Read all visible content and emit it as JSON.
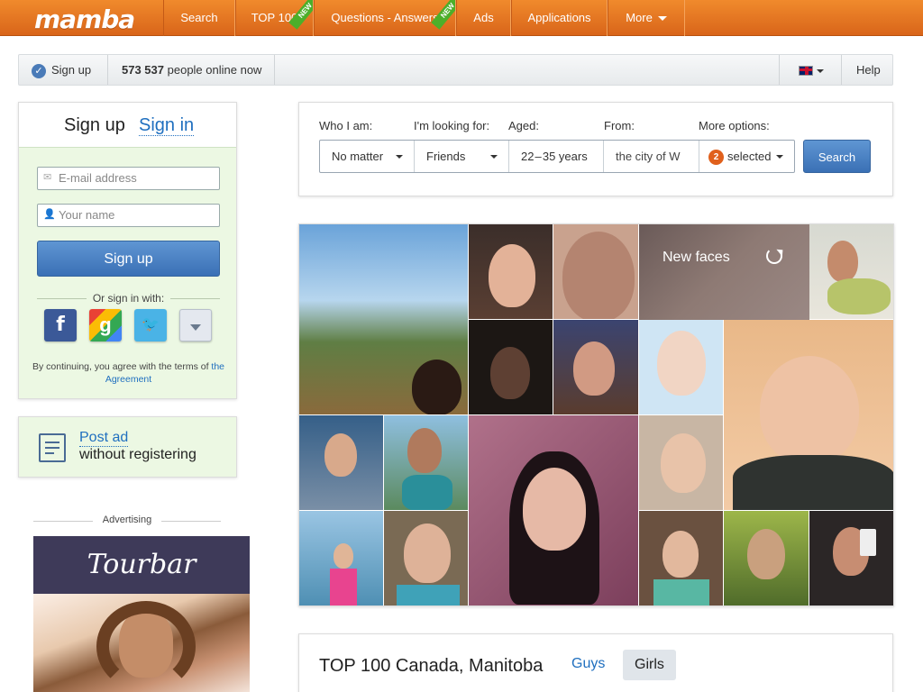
{
  "header": {
    "logo": "mamba",
    "nav": [
      {
        "label": "Search"
      },
      {
        "label": "TOP 100",
        "new_badge": "NEW"
      },
      {
        "label": "Questions - Answers",
        "new_badge": "NEW"
      },
      {
        "label": "Ads"
      },
      {
        "label": "Applications"
      },
      {
        "label": "More"
      }
    ]
  },
  "statusbar": {
    "signup_label": "Sign up",
    "online_count": "573 537",
    "online_text": "people online now",
    "help_label": "Help"
  },
  "signup_panel": {
    "tab_signup": "Sign up",
    "tab_signin": "Sign in",
    "email_placeholder": "E-mail address",
    "name_placeholder": "Your name",
    "button": "Sign up",
    "or_sign_in": "Or sign in with:",
    "terms_prefix": "By continuing, you agree with the terms of",
    "terms_link": "the Agreement"
  },
  "post_ad": {
    "link": "Post ad",
    "subtitle": "without registering"
  },
  "advertising": {
    "label": "Advertising",
    "brand": "Tourbar"
  },
  "search_form": {
    "labels": {
      "who": "Who I am:",
      "looking": "I'm looking for:",
      "aged": "Aged:",
      "from": "From:",
      "more": "More options:"
    },
    "values": {
      "who": "No matter",
      "looking": "Friends",
      "aged": "22 – 35  years",
      "from": "the city of W",
      "more_count": "2",
      "more": "selected"
    },
    "button": "Search"
  },
  "faces": {
    "title": "New faces"
  },
  "top100": {
    "title": "TOP 100 Canada, Manitoba",
    "guys": "Guys",
    "girls": "Girls"
  },
  "colors": {
    "brand_orange": "#e8772a",
    "link_blue": "#1f6fbf",
    "button_blue": "#3a70b5",
    "panel_green": "#ecf8e3"
  }
}
